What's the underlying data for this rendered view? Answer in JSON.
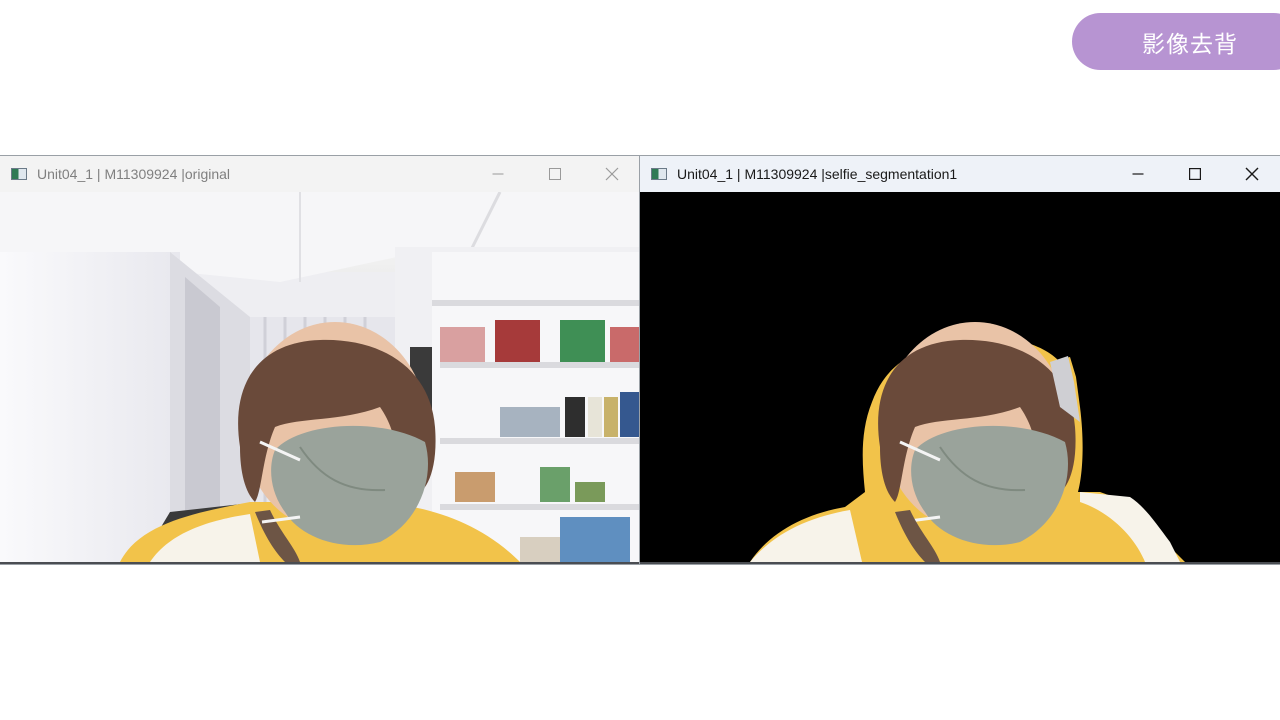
{
  "slide": {
    "badge_label": "影像去背"
  },
  "windows": [
    {
      "title": "Unit04_1 | M11309924 |original",
      "state": "inactive",
      "controls": [
        "minimize-icon",
        "maximize-icon",
        "close-icon"
      ]
    },
    {
      "title": "Unit04_1 | M11309924 |selfie_segmentation1",
      "state": "active",
      "controls": [
        "minimize-icon",
        "maximize-icon",
        "close-icon"
      ]
    }
  ],
  "colors": {
    "badge": "#b794d2",
    "mask": "#9aa39b",
    "shirt": "#f2c34a",
    "hair": "#6a4a3a",
    "background_removed": "#000000"
  }
}
